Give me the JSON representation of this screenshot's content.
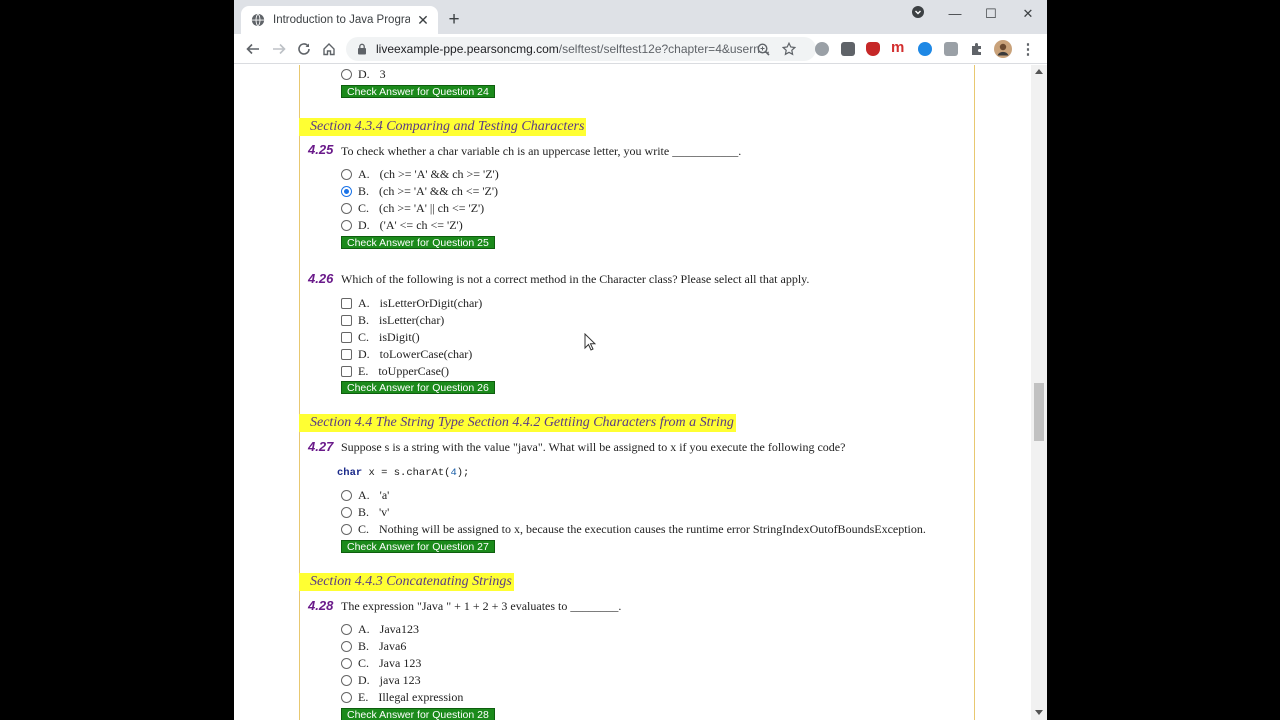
{
  "browser": {
    "tab_title": "Introduction to Java Programmin",
    "url_host": "liveexample-ppe.pearsoncmg.com",
    "url_rest": "/selftest/selftest12e?chapter=4&usern..."
  },
  "prev": {
    "option_d": {
      "letter": "D.",
      "text": "3"
    },
    "check_label": "Check Answer for Question 24"
  },
  "sections": {
    "s1": "Section 4.3.4 Comparing and Testing Characters",
    "s2": "Section 4.4 The String Type   Section 4.4.2 Gettiing Characters from a String",
    "s3": "Section 4.4.3 Concatenating Strings"
  },
  "q25": {
    "num": "4.25",
    "text": "To check whether a char variable ch is an uppercase letter, you write ___________.",
    "options": [
      {
        "letter": "A.",
        "text": "(ch >= 'A' && ch >= 'Z')"
      },
      {
        "letter": "B.",
        "text": "(ch >= 'A' && ch <= 'Z')"
      },
      {
        "letter": "C.",
        "text": "(ch >= 'A' || ch <= 'Z')"
      },
      {
        "letter": "D.",
        "text": "('A' <= ch <= 'Z')"
      }
    ],
    "selected": "B.",
    "check_label": "Check Answer for Question 25"
  },
  "q26": {
    "num": "4.26",
    "text": "Which of the following is not a correct method in the Character class? Please select all that apply.",
    "options": [
      {
        "letter": "A.",
        "text": "isLetterOrDigit(char)"
      },
      {
        "letter": "B.",
        "text": "isLetter(char)"
      },
      {
        "letter": "C.",
        "text": "isDigit()"
      },
      {
        "letter": "D.",
        "text": "toLowerCase(char)"
      },
      {
        "letter": "E.",
        "text": "toUpperCase()"
      }
    ],
    "check_label": "Check Answer for Question 26"
  },
  "q27": {
    "num": "4.27",
    "text": "Suppose s is a string with the value \"java\". What will be assigned to x if you execute the following code?",
    "code_kw": "char",
    "code_mid": " x = s.charAt(",
    "code_num": "4",
    "code_end": ");",
    "options": [
      {
        "letter": "A.",
        "text": "'a'"
      },
      {
        "letter": "B.",
        "text": "'v'"
      },
      {
        "letter": "C.",
        "text": "Nothing will be assigned to x, because the execution causes the runtime error StringIndexOutofBoundsException."
      }
    ],
    "check_label": "Check Answer for Question 27"
  },
  "q28": {
    "num": "4.28",
    "text": "The expression \"Java \" + 1 + 2 + 3 evaluates to ________.",
    "options": [
      {
        "letter": "A.",
        "text": "Java123"
      },
      {
        "letter": "B.",
        "text": "Java6"
      },
      {
        "letter": "C.",
        "text": "Java 123"
      },
      {
        "letter": "D.",
        "text": "java 123"
      },
      {
        "letter": "E.",
        "text": "Illegal expression"
      }
    ],
    "check_label": "Check Answer for Question 28"
  },
  "colors": {
    "section_bg": "#ffff33",
    "qnum": "#6a1a8a",
    "button_bg": "#1b8a1b"
  },
  "icons": [
    "globe-icon",
    "lock-icon",
    "back-icon",
    "forward-icon",
    "reload-icon",
    "home-icon",
    "zoom-icon",
    "star-icon",
    "extensions-icon",
    "menu-icon"
  ]
}
